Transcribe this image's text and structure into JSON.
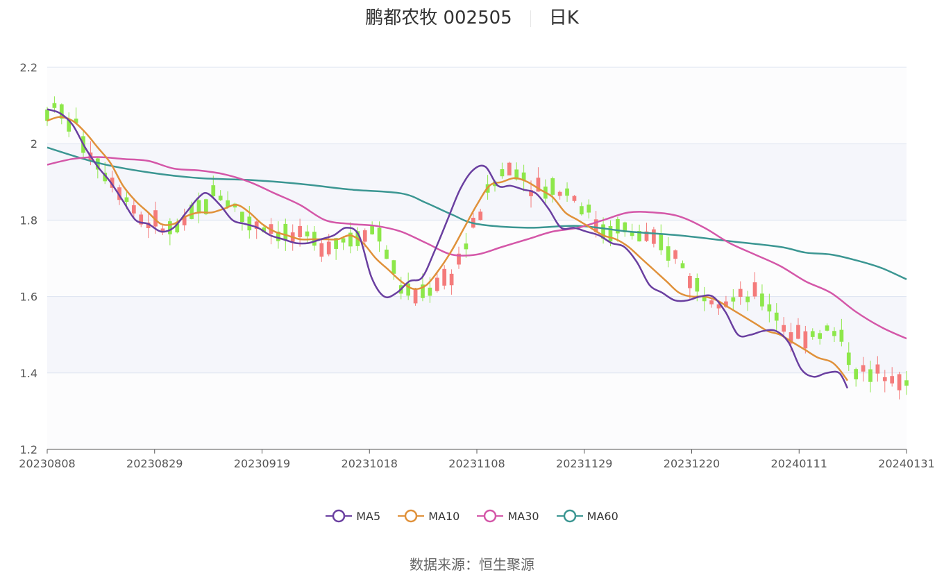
{
  "header": {
    "name_code": "鹏都农牧 002505",
    "period": "日K"
  },
  "source": {
    "label": "数据来源：",
    "value": "恒生聚源"
  },
  "chart_data": {
    "type": "candlestick",
    "y_ticks": [
      "2.2",
      "2",
      "1.8",
      "1.6",
      "1.4",
      "1.2"
    ],
    "ylim": [
      1.2,
      2.2
    ],
    "x_ticks": [
      "20230808",
      "20230829",
      "20230919",
      "20231018",
      "20231108",
      "20231129",
      "20231220",
      "20240111",
      "20240131"
    ],
    "n_bars": 120,
    "colors": {
      "up": "#f47b7b",
      "down": "#8de74a",
      "MA5": "#6a3fa0",
      "MA10": "#e0913a",
      "MA30": "#d457a8",
      "MA60": "#3b9692"
    },
    "series": [
      {
        "name": "MA5",
        "key": "ma5"
      },
      {
        "name": "MA10",
        "key": "ma10"
      },
      {
        "name": "MA30",
        "key": "ma30"
      },
      {
        "name": "MA60",
        "key": "ma60"
      }
    ],
    "ma5_points": [
      [
        0,
        2.09
      ],
      [
        3,
        2.08
      ],
      [
        6,
        2.05
      ],
      [
        9,
        1.99
      ],
      [
        12,
        1.94
      ],
      [
        15,
        1.9
      ],
      [
        18,
        1.85
      ],
      [
        21,
        1.8
      ],
      [
        24,
        1.79
      ],
      [
        27,
        1.77
      ],
      [
        30,
        1.78
      ],
      [
        33,
        1.82
      ],
      [
        36,
        1.86
      ],
      [
        38,
        1.87
      ],
      [
        41,
        1.84
      ],
      [
        44,
        1.8
      ],
      [
        47,
        1.79
      ],
      [
        50,
        1.78
      ],
      [
        53,
        1.76
      ],
      [
        56,
        1.75
      ],
      [
        59,
        1.74
      ],
      [
        62,
        1.74
      ],
      [
        65,
        1.75
      ],
      [
        68,
        1.76
      ],
      [
        71,
        1.78
      ],
      [
        74,
        1.76
      ],
      [
        77,
        1.65
      ],
      [
        80,
        1.6
      ],
      [
        83,
        1.61
      ],
      [
        86,
        1.64
      ],
      [
        89,
        1.65
      ],
      [
        92,
        1.72
      ],
      [
        95,
        1.8
      ],
      [
        98,
        1.88
      ],
      [
        101,
        1.93
      ],
      [
        104,
        1.94
      ],
      [
        107,
        1.89
      ],
      [
        110,
        1.89
      ],
      [
        113,
        1.88
      ],
      [
        116,
        1.87
      ],
      [
        119,
        1.83
      ],
      [
        122,
        1.78
      ],
      [
        125,
        1.78
      ],
      [
        128,
        1.77
      ],
      [
        131,
        1.76
      ],
      [
        134,
        1.74
      ],
      [
        137,
        1.73
      ],
      [
        140,
        1.69
      ],
      [
        143,
        1.63
      ],
      [
        146,
        1.61
      ],
      [
        149,
        1.59
      ],
      [
        152,
        1.59
      ],
      [
        155,
        1.6
      ],
      [
        158,
        1.6
      ],
      [
        161,
        1.56
      ],
      [
        164,
        1.5
      ],
      [
        167,
        1.5
      ],
      [
        170,
        1.51
      ],
      [
        173,
        1.51
      ],
      [
        176,
        1.48
      ],
      [
        179,
        1.41
      ],
      [
        182,
        1.39
      ],
      [
        185,
        1.4
      ],
      [
        188,
        1.4
      ],
      [
        190,
        1.36
      ]
    ],
    "ma10_points": [
      [
        0,
        2.06
      ],
      [
        3,
        2.07
      ],
      [
        6,
        2.06
      ],
      [
        9,
        2.03
      ],
      [
        12,
        1.99
      ],
      [
        15,
        1.95
      ],
      [
        18,
        1.89
      ],
      [
        21,
        1.85
      ],
      [
        24,
        1.82
      ],
      [
        27,
        1.79
      ],
      [
        30,
        1.79
      ],
      [
        33,
        1.81
      ],
      [
        36,
        1.82
      ],
      [
        39,
        1.82
      ],
      [
        42,
        1.83
      ],
      [
        45,
        1.84
      ],
      [
        48,
        1.82
      ],
      [
        51,
        1.79
      ],
      [
        54,
        1.77
      ],
      [
        57,
        1.76
      ],
      [
        60,
        1.75
      ],
      [
        63,
        1.75
      ],
      [
        66,
        1.75
      ],
      [
        69,
        1.75
      ],
      [
        72,
        1.76
      ],
      [
        75,
        1.74
      ],
      [
        78,
        1.7
      ],
      [
        81,
        1.67
      ],
      [
        84,
        1.64
      ],
      [
        87,
        1.62
      ],
      [
        90,
        1.63
      ],
      [
        93,
        1.67
      ],
      [
        96,
        1.72
      ],
      [
        99,
        1.78
      ],
      [
        102,
        1.84
      ],
      [
        105,
        1.89
      ],
      [
        108,
        1.9
      ],
      [
        111,
        1.91
      ],
      [
        114,
        1.9
      ],
      [
        117,
        1.88
      ],
      [
        120,
        1.86
      ],
      [
        123,
        1.82
      ],
      [
        126,
        1.8
      ],
      [
        129,
        1.78
      ],
      [
        132,
        1.76
      ],
      [
        135,
        1.75
      ],
      [
        138,
        1.73
      ],
      [
        141,
        1.7
      ],
      [
        144,
        1.67
      ],
      [
        147,
        1.64
      ],
      [
        150,
        1.61
      ],
      [
        153,
        1.6
      ],
      [
        156,
        1.6
      ],
      [
        159,
        1.59
      ],
      [
        162,
        1.57
      ],
      [
        165,
        1.55
      ],
      [
        168,
        1.53
      ],
      [
        171,
        1.51
      ],
      [
        174,
        1.5
      ],
      [
        177,
        1.48
      ],
      [
        180,
        1.46
      ],
      [
        183,
        1.44
      ],
      [
        186,
        1.43
      ],
      [
        188,
        1.41
      ],
      [
        190,
        1.38
      ]
    ],
    "ma30_points": [
      [
        0,
        1.945
      ],
      [
        6,
        1.96
      ],
      [
        12,
        1.965
      ],
      [
        18,
        1.96
      ],
      [
        24,
        1.955
      ],
      [
        30,
        1.935
      ],
      [
        36,
        1.93
      ],
      [
        42,
        1.92
      ],
      [
        48,
        1.9
      ],
      [
        54,
        1.87
      ],
      [
        60,
        1.84
      ],
      [
        66,
        1.8
      ],
      [
        72,
        1.79
      ],
      [
        78,
        1.785
      ],
      [
        84,
        1.77
      ],
      [
        90,
        1.74
      ],
      [
        96,
        1.71
      ],
      [
        102,
        1.71
      ],
      [
        108,
        1.73
      ],
      [
        114,
        1.75
      ],
      [
        120,
        1.77
      ],
      [
        126,
        1.78
      ],
      [
        132,
        1.8
      ],
      [
        138,
        1.82
      ],
      [
        144,
        1.82
      ],
      [
        150,
        1.81
      ],
      [
        156,
        1.78
      ],
      [
        162,
        1.74
      ],
      [
        168,
        1.71
      ],
      [
        174,
        1.68
      ],
      [
        180,
        1.64
      ],
      [
        186,
        1.61
      ],
      [
        192,
        1.56
      ],
      [
        198,
        1.52
      ],
      [
        204,
        1.49
      ]
    ],
    "ma60_points": [
      [
        0,
        1.99
      ],
      [
        12,
        1.95
      ],
      [
        24,
        1.925
      ],
      [
        36,
        1.91
      ],
      [
        48,
        1.905
      ],
      [
        60,
        1.895
      ],
      [
        72,
        1.88
      ],
      [
        84,
        1.87
      ],
      [
        90,
        1.845
      ],
      [
        96,
        1.815
      ],
      [
        102,
        1.79
      ],
      [
        114,
        1.78
      ],
      [
        126,
        1.785
      ],
      [
        138,
        1.77
      ],
      [
        150,
        1.76
      ],
      [
        162,
        1.745
      ],
      [
        174,
        1.73
      ],
      [
        180,
        1.715
      ],
      [
        186,
        1.71
      ],
      [
        192,
        1.695
      ],
      [
        198,
        1.675
      ],
      [
        204,
        1.645
      ]
    ]
  }
}
